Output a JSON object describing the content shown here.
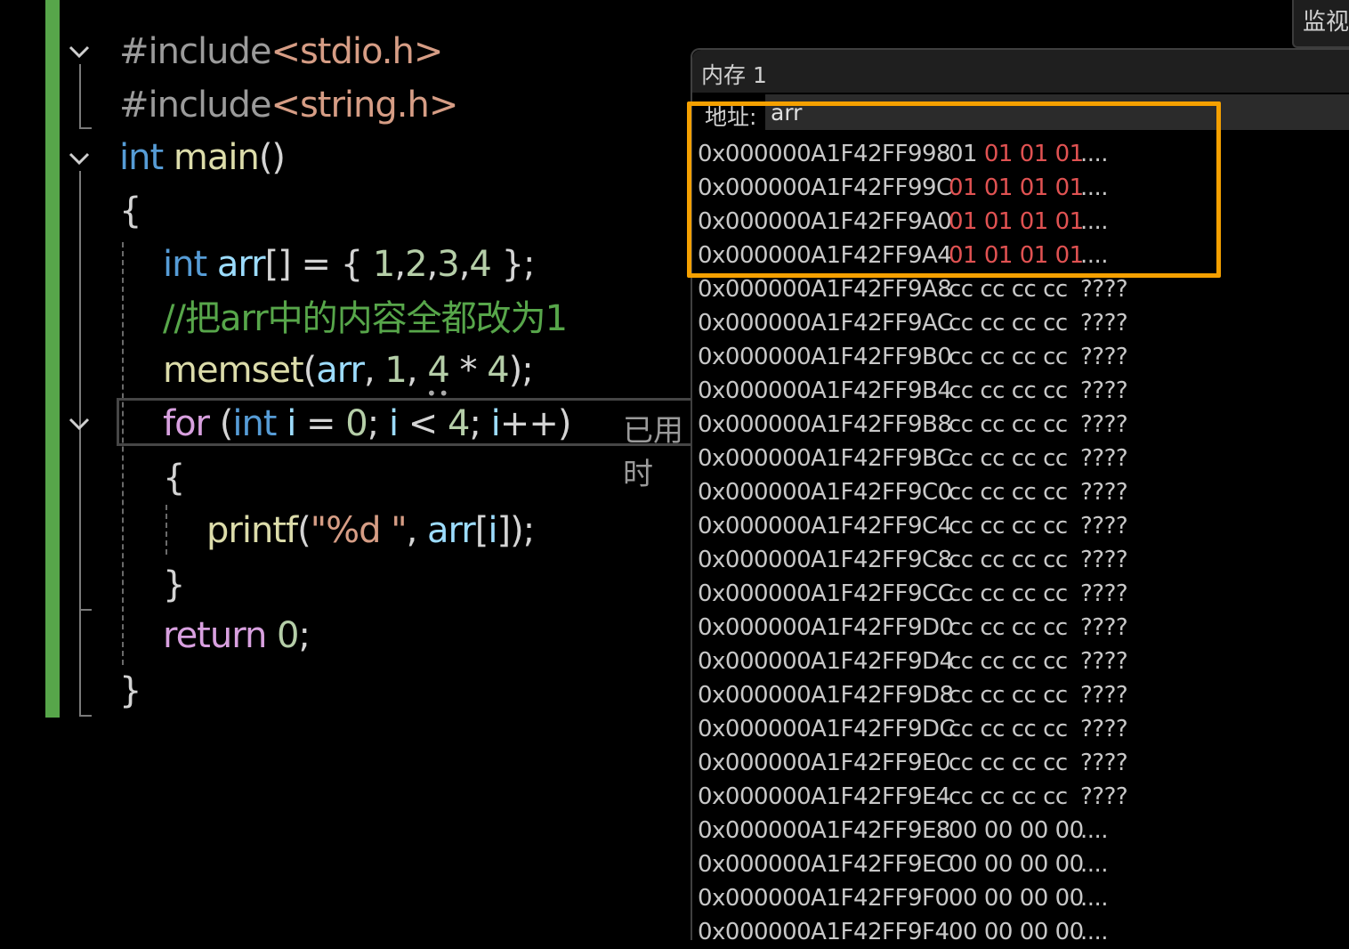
{
  "editor": {
    "lines": [
      [
        {
          "t": "#include",
          "c": "pp"
        },
        {
          "t": "<stdio.h>",
          "c": "hdr"
        }
      ],
      [
        {
          "t": "#include",
          "c": "pp"
        },
        {
          "t": "<string.h>",
          "c": "hdr"
        }
      ],
      [
        {
          "t": "int",
          "c": "kw"
        },
        {
          "t": " ",
          "c": "pn"
        },
        {
          "t": "main",
          "c": "fn"
        },
        {
          "t": "()",
          "c": "pn"
        }
      ],
      [
        {
          "t": "{",
          "c": "pn"
        }
      ],
      [
        {
          "t": "int",
          "c": "kw"
        },
        {
          "t": " ",
          "c": "pn"
        },
        {
          "t": "arr",
          "c": "var"
        },
        {
          "t": "[] = { ",
          "c": "pn"
        },
        {
          "t": "1",
          "c": "num"
        },
        {
          "t": ",",
          "c": "pn"
        },
        {
          "t": "2",
          "c": "num"
        },
        {
          "t": ",",
          "c": "pn"
        },
        {
          "t": "3",
          "c": "num"
        },
        {
          "t": ",",
          "c": "pn"
        },
        {
          "t": "4",
          "c": "num"
        },
        {
          "t": " };",
          "c": "pn"
        }
      ],
      [
        {
          "t": "//把arr中的内容全都改为1",
          "c": "cmt"
        }
      ],
      [
        {
          "t": "memset",
          "c": "fn"
        },
        {
          "t": "(",
          "c": "pn"
        },
        {
          "t": "arr",
          "c": "var"
        },
        {
          "t": ", ",
          "c": "pn"
        },
        {
          "t": "1",
          "c": "num"
        },
        {
          "t": ", ",
          "c": "pn"
        },
        {
          "t": "4",
          "c": "num"
        },
        {
          "t": " * ",
          "c": "pn"
        },
        {
          "t": "4",
          "c": "num"
        },
        {
          "t": ");",
          "c": "pn"
        }
      ],
      [
        {
          "t": "for",
          "c": "ctl"
        },
        {
          "t": " (",
          "c": "pn"
        },
        {
          "t": "int",
          "c": "kw"
        },
        {
          "t": " ",
          "c": "pn"
        },
        {
          "t": "i",
          "c": "var"
        },
        {
          "t": " = ",
          "c": "pn"
        },
        {
          "t": "0",
          "c": "num"
        },
        {
          "t": "; ",
          "c": "pn"
        },
        {
          "t": "i",
          "c": "var"
        },
        {
          "t": " < ",
          "c": "pn"
        },
        {
          "t": "4",
          "c": "num"
        },
        {
          "t": "; ",
          "c": "pn"
        },
        {
          "t": "i",
          "c": "var"
        },
        {
          "t": "++)",
          "c": "pn"
        }
      ],
      [
        {
          "t": "{",
          "c": "pn"
        }
      ],
      [
        {
          "t": "printf",
          "c": "fn"
        },
        {
          "t": "(",
          "c": "pn"
        },
        {
          "t": "\"%d \"",
          "c": "str"
        },
        {
          "t": ", ",
          "c": "pn"
        },
        {
          "t": "arr",
          "c": "var"
        },
        {
          "t": "[",
          "c": "pn"
        },
        {
          "t": "i",
          "c": "var"
        },
        {
          "t": "]);",
          "c": "pn"
        }
      ],
      [
        {
          "t": "}",
          "c": "pn"
        }
      ],
      [
        {
          "t": "return",
          "c": "ctl"
        },
        {
          "t": " ",
          "c": "pn"
        },
        {
          "t": "0",
          "c": "num"
        },
        {
          "t": ";",
          "c": "pn"
        }
      ],
      [
        {
          "t": "}",
          "c": "pn"
        }
      ]
    ],
    "elapsed_hint": "已用时"
  },
  "watch_tab": {
    "label": "监视"
  },
  "memory": {
    "title": "内存 1",
    "address_label": "地址:",
    "address_value": "arr",
    "rows": [
      {
        "addr": "0x000000A1F42FF998",
        "bytes": [
          "01",
          "01",
          "01",
          "01"
        ],
        "changed": [
          false,
          true,
          true,
          true
        ],
        "ascii": "...."
      },
      {
        "addr": "0x000000A1F42FF99C",
        "bytes": [
          "01",
          "01",
          "01",
          "01"
        ],
        "changed": [
          true,
          true,
          true,
          true
        ],
        "ascii": "...."
      },
      {
        "addr": "0x000000A1F42FF9A0",
        "bytes": [
          "01",
          "01",
          "01",
          "01"
        ],
        "changed": [
          true,
          true,
          true,
          true
        ],
        "ascii": "...."
      },
      {
        "addr": "0x000000A1F42FF9A4",
        "bytes": [
          "01",
          "01",
          "01",
          "01"
        ],
        "changed": [
          true,
          true,
          true,
          true
        ],
        "ascii": "...."
      },
      {
        "addr": "0x000000A1F42FF9A8",
        "bytes": [
          "cc",
          "cc",
          "cc",
          "cc"
        ],
        "ascii": "????"
      },
      {
        "addr": "0x000000A1F42FF9AC",
        "bytes": [
          "cc",
          "cc",
          "cc",
          "cc"
        ],
        "ascii": "????"
      },
      {
        "addr": "0x000000A1F42FF9B0",
        "bytes": [
          "cc",
          "cc",
          "cc",
          "cc"
        ],
        "ascii": "????"
      },
      {
        "addr": "0x000000A1F42FF9B4",
        "bytes": [
          "cc",
          "cc",
          "cc",
          "cc"
        ],
        "ascii": "????"
      },
      {
        "addr": "0x000000A1F42FF9B8",
        "bytes": [
          "cc",
          "cc",
          "cc",
          "cc"
        ],
        "ascii": "????"
      },
      {
        "addr": "0x000000A1F42FF9BC",
        "bytes": [
          "cc",
          "cc",
          "cc",
          "cc"
        ],
        "ascii": "????"
      },
      {
        "addr": "0x000000A1F42FF9C0",
        "bytes": [
          "cc",
          "cc",
          "cc",
          "cc"
        ],
        "ascii": "????"
      },
      {
        "addr": "0x000000A1F42FF9C4",
        "bytes": [
          "cc",
          "cc",
          "cc",
          "cc"
        ],
        "ascii": "????"
      },
      {
        "addr": "0x000000A1F42FF9C8",
        "bytes": [
          "cc",
          "cc",
          "cc",
          "cc"
        ],
        "ascii": "????"
      },
      {
        "addr": "0x000000A1F42FF9CC",
        "bytes": [
          "cc",
          "cc",
          "cc",
          "cc"
        ],
        "ascii": "????"
      },
      {
        "addr": "0x000000A1F42FF9D0",
        "bytes": [
          "cc",
          "cc",
          "cc",
          "cc"
        ],
        "ascii": "????"
      },
      {
        "addr": "0x000000A1F42FF9D4",
        "bytes": [
          "cc",
          "cc",
          "cc",
          "cc"
        ],
        "ascii": "????"
      },
      {
        "addr": "0x000000A1F42FF9D8",
        "bytes": [
          "cc",
          "cc",
          "cc",
          "cc"
        ],
        "ascii": "????"
      },
      {
        "addr": "0x000000A1F42FF9DC",
        "bytes": [
          "cc",
          "cc",
          "cc",
          "cc"
        ],
        "ascii": "????"
      },
      {
        "addr": "0x000000A1F42FF9E0",
        "bytes": [
          "cc",
          "cc",
          "cc",
          "cc"
        ],
        "ascii": "????"
      },
      {
        "addr": "0x000000A1F42FF9E4",
        "bytes": [
          "cc",
          "cc",
          "cc",
          "cc"
        ],
        "ascii": "????"
      },
      {
        "addr": "0x000000A1F42FF9E8",
        "bytes": [
          "00",
          "00",
          "00",
          "00"
        ],
        "ascii": "...."
      },
      {
        "addr": "0x000000A1F42FF9EC",
        "bytes": [
          "00",
          "00",
          "00",
          "00"
        ],
        "ascii": "...."
      },
      {
        "addr": "0x000000A1F42FF9F0",
        "bytes": [
          "00",
          "00",
          "00",
          "00"
        ],
        "ascii": "...."
      },
      {
        "addr": "0x000000A1F42FF9F4",
        "bytes": [
          "00",
          "00",
          "00",
          "00"
        ],
        "ascii": "...."
      }
    ]
  },
  "colors": {
    "accent_highlight": "#f5a000",
    "changed_byte": "#e05252",
    "change_bar": "#57a64a"
  }
}
